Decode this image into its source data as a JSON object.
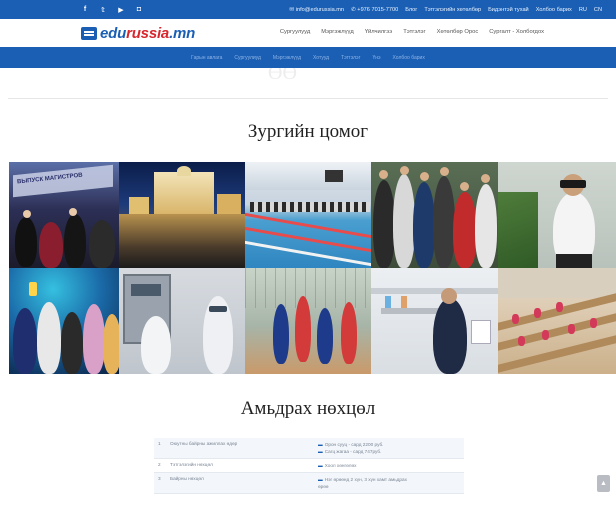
{
  "topbar": {
    "social": [
      {
        "icon": "facebook-icon",
        "glyph": "f"
      },
      {
        "icon": "twitter-icon",
        "glyph": "𝕥"
      },
      {
        "icon": "youtube-icon",
        "glyph": "▶"
      },
      {
        "icon": "instagram-icon",
        "glyph": "◘"
      }
    ],
    "email": "✉ info@edurussia.mn",
    "phone": "✆ +976 7015-7700",
    "links": [
      "Блог",
      "Тэтгэлэгийн хөтөлбөр",
      "Бидэнтэй тухай",
      "Холбоо барих",
      "RU",
      "CN"
    ]
  },
  "header": {
    "logo_main": "edu",
    "logo_accent": "russia",
    "logo_tail": ".mn",
    "nav": [
      "Сургуулууд",
      "Мэргэжлүүд",
      "Үйлчилгээ",
      "Тэтгэлэг",
      "Хөтөлбөр Орос",
      "Сургалт - Холбогдох"
    ]
  },
  "band": {
    "items": [
      "Гарын авлага",
      "Сургуулиуд",
      "Мэргэжлүүд",
      "Хотууд",
      "Тэтгэлэг",
      "Үнэ",
      "Холбоо барих"
    ]
  },
  "ghost_title": "ӨӨ",
  "gallery_title": "Зургийн цомог",
  "gallery": {
    "banner_text": "ВЫПУСК МАГИСТРОВ"
  },
  "conditions_title": "Амьдрах нөхцөл",
  "conditions": [
    {
      "num": "1",
      "item": "Оюутны байрны ажиллах өдөр",
      "lines": [
        "Орон сууц - сард 2200 руб.",
        "Сагц жагаа - сард 747руб."
      ]
    },
    {
      "num": "2",
      "item": "Тэтгэлэгийн нөхцөл",
      "lines": [
        "Хоол хөнгөлөх"
      ]
    },
    {
      "num": "3",
      "item": "Байрны нөхцөл",
      "lines": [
        "Нэг өрөөнд 2 хүн, 3 хүн хамт амьдрах",
        "өрөө"
      ]
    }
  ],
  "colors": {
    "primary": "#1a5fb4",
    "accent": "#d7262e"
  }
}
